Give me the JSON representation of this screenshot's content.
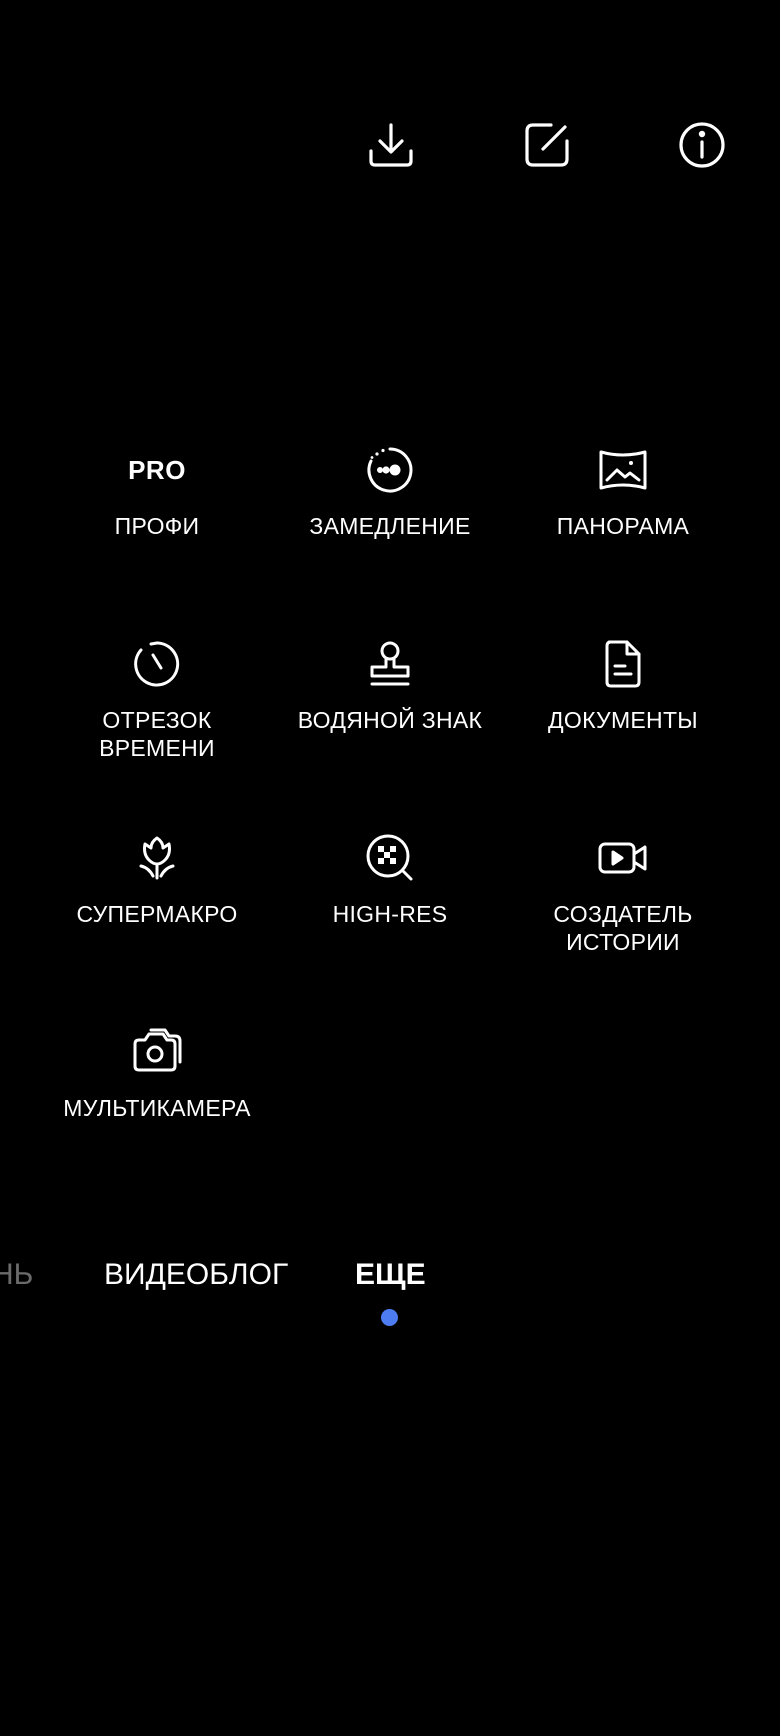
{
  "top_bar": {
    "icons": [
      "download-icon",
      "edit-icon",
      "info-icon"
    ]
  },
  "modes": [
    {
      "name": "pro",
      "icon_text": "PRO",
      "label": "ПРОФИ"
    },
    {
      "name": "slow-motion",
      "icon": "slow-motion-icon",
      "label": "ЗАМЕДЛЕНИЕ"
    },
    {
      "name": "panorama",
      "icon": "panorama-icon",
      "label": "ПАНОРАМА"
    },
    {
      "name": "time-lapse",
      "icon": "timer-icon",
      "label": "ОТРЕЗОК\nВРЕМЕНИ"
    },
    {
      "name": "watermark",
      "icon": "stamp-icon",
      "label": "ВОДЯНОЙ ЗНАК"
    },
    {
      "name": "documents",
      "icon": "document-icon",
      "label": "ДОКУМЕНТЫ"
    },
    {
      "name": "super-macro",
      "icon": "flower-icon",
      "label": "СУПЕРМАКРО"
    },
    {
      "name": "high-res",
      "icon": "high-res-icon",
      "label": "HIGH-RES"
    },
    {
      "name": "story-creator",
      "icon": "video-icon",
      "label": "СОЗДАТЕЛЬ\nИСТОРИИ"
    },
    {
      "name": "multi-camera",
      "icon": "camera-icon",
      "label": "МУЛЬТИКАМЕРА"
    }
  ],
  "mode_tabs": {
    "partial": "НЬ",
    "videoblog": "ВИДЕОБЛОГ",
    "more": "ЕЩЕ"
  },
  "colors": {
    "background": "#000000",
    "foreground": "#ffffff",
    "accent": "#4d7cf0",
    "inactive": "#6b6b6b"
  }
}
